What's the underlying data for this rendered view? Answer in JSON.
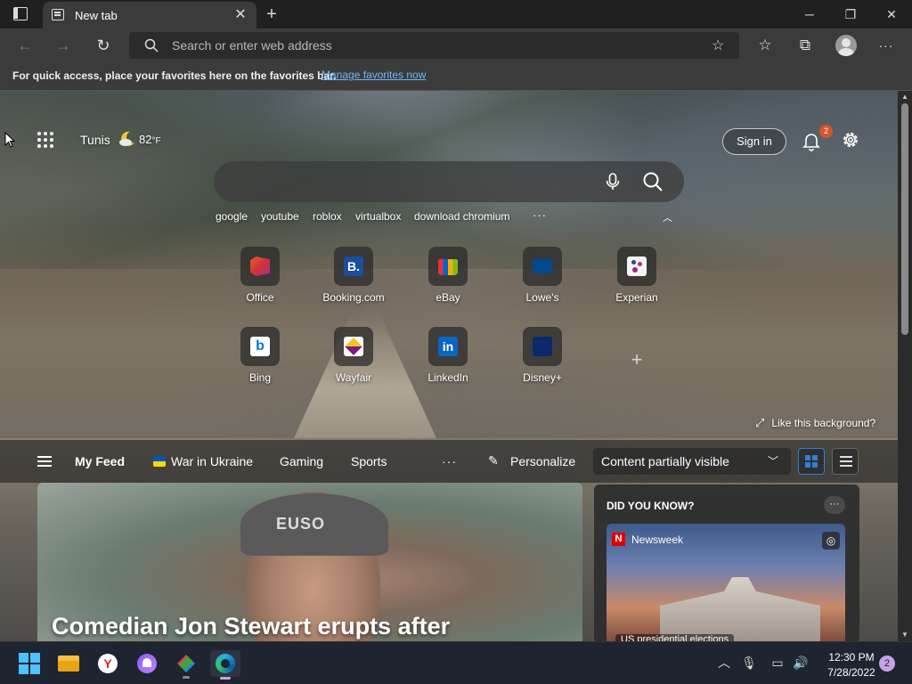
{
  "tab": {
    "title": "New tab"
  },
  "address": {
    "placeholder": "Search or enter web address"
  },
  "favorites_bar": {
    "message": "For quick access, place your favorites here on the favorites bar.",
    "link": "Manage favorites now"
  },
  "weather": {
    "city": "Tunis",
    "temp": "82",
    "unit": "°F"
  },
  "header": {
    "signin": "Sign in",
    "notification_count": "2"
  },
  "trending": [
    "google",
    "youtube",
    "roblox",
    "virtualbox",
    "download chromium"
  ],
  "trending_more": "···",
  "tiles": [
    {
      "label": "Office"
    },
    {
      "label": "Booking.com"
    },
    {
      "label": "eBay"
    },
    {
      "label": "Lowe's"
    },
    {
      "label": "Experian"
    },
    {
      "label": "Bing"
    },
    {
      "label": "Wayfair"
    },
    {
      "label": "LinkedIn"
    },
    {
      "label": "Disney+"
    }
  ],
  "background": {
    "like_label": "Like this background?"
  },
  "feed": {
    "my_feed": "My Feed",
    "items": [
      "War in Ukraine",
      "Gaming",
      "Sports"
    ],
    "more": "···",
    "personalize": "Personalize",
    "visibility": "Content partially visible"
  },
  "hero": {
    "headline": "Comedian Jon Stewart erupts after",
    "cap_text": "EUSO"
  },
  "did_you_know": {
    "title": "DID YOU KNOW?",
    "more": "···",
    "source": "Newsweek",
    "caption": "US presidential elections"
  },
  "taskbar": {
    "time": "12:30 PM",
    "date": "7/28/2022",
    "notifications": "2"
  },
  "colors": {
    "accent": "#0078d4",
    "link": "#6cb8ff",
    "badge": "#d9532c"
  }
}
